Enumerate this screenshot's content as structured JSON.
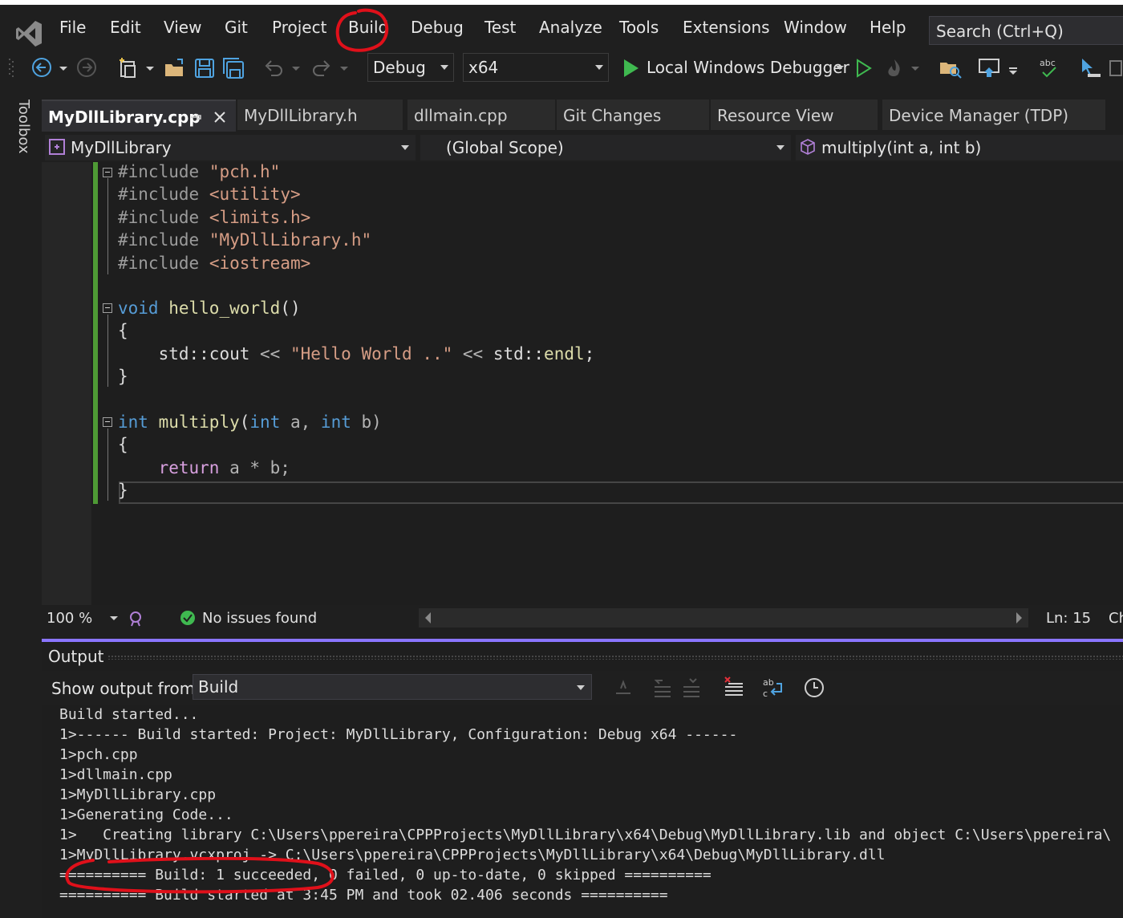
{
  "menu": {
    "items": [
      "File",
      "Edit",
      "View",
      "Git",
      "Project",
      "Build",
      "Debug",
      "Test",
      "Analyze",
      "Tools",
      "Extensions",
      "Window",
      "Help"
    ],
    "search_placeholder": "Search (Ctrl+Q)"
  },
  "toolbar": {
    "configuration": "Debug",
    "platform": "x64",
    "debugger": "Local Windows Debugger"
  },
  "toolbox": {
    "label": "Toolbox"
  },
  "tabs": [
    {
      "label": "MyDllLibrary.cpp",
      "active": true
    },
    {
      "label": "MyDllLibrary.h"
    },
    {
      "label": "dllmain.cpp"
    },
    {
      "label": "Git Changes"
    },
    {
      "label": "Resource View"
    },
    {
      "label": "Device Manager (TDP)"
    }
  ],
  "navbar": {
    "project": "MyDllLibrary",
    "scope": "(Global Scope)",
    "member": "multiply(int a, int b)"
  },
  "editor": {
    "zoom": "100 %",
    "issues": "No issues found",
    "line": "Ln: 15",
    "col_prefix": "Ch",
    "code": {
      "l1_kw": "#include",
      "l1_str": "\"pch.h\"",
      "l2_kw": "#include",
      "l2_str": "<utility>",
      "l3_kw": "#include",
      "l3_str": "<limits.h>",
      "l4_kw": "#include",
      "l4_str": "\"MyDllLibrary.h\"",
      "l5_kw": "#include",
      "l5_str": "<iostream>",
      "l7_type": "void",
      "l7_fn": "hello_world",
      "l7_rest": "()",
      "brace_open": "{",
      "l9_a": "std::",
      "l9_b": "cout",
      "l9_c": " << ",
      "l9_str": "\"Hello World ..\"",
      "l9_d": " << ",
      "l9_e": "std::",
      "l9_f": "endl",
      "l9_g": ";",
      "brace_close": "}",
      "l12_type": "int",
      "l12_fn": "multiply",
      "l12_p1": "(",
      "l12_t1": "int",
      "l12_a": " a, ",
      "l12_t2": "int",
      "l12_b": " b)",
      "l14_ret": "return",
      "l14_rest": " a * b;"
    }
  },
  "output": {
    "title": "Output",
    "show_from_label": "Show output from:",
    "source": "Build",
    "lines": [
      "Build started...",
      "1>------ Build started: Project: MyDllLibrary, Configuration: Debug x64 ------",
      "1>pch.cpp",
      "1>dllmain.cpp",
      "1>MyDllLibrary.cpp",
      "1>Generating Code...",
      "1>   Creating library C:\\Users\\ppereira\\CPPProjects\\MyDllLibrary\\x64\\Debug\\MyDllLibrary.lib and object C:\\Users\\ppereira\\",
      "1>MyDllLibrary.vcxproj -> C:\\Users\\ppereira\\CPPProjects\\MyDllLibrary\\x64\\Debug\\MyDllLibrary.dll",
      "========== Build: 1 succeeded, 0 failed, 0 up-to-date, 0 skipped ==========",
      "========== Build started at 3:45 PM and took 02.406 seconds =========="
    ]
  },
  "colors": {
    "annotation": "#e0101a",
    "accent": "#8a75ff",
    "play": "#3fb950"
  }
}
